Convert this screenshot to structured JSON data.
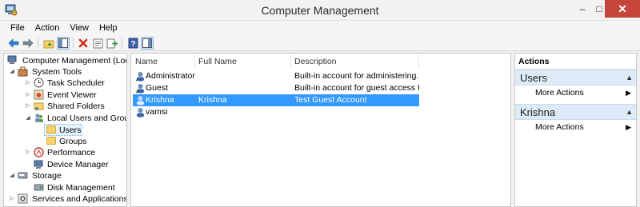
{
  "window": {
    "title": "Computer Management",
    "minimize_glyph": "–",
    "maximize_glyph": "□",
    "close_glyph": "✕"
  },
  "menu": [
    "File",
    "Action",
    "View",
    "Help"
  ],
  "toolbar": [
    {
      "icon": "back-arrow-icon"
    },
    {
      "icon": "forward-arrow-icon"
    },
    {
      "icon": "up-folder-icon"
    },
    {
      "icon": "show-hide-console-tree-icon"
    },
    {
      "icon": "delete-icon"
    },
    {
      "icon": "properties-icon"
    },
    {
      "icon": "export-list-icon"
    },
    {
      "icon": "help-icon"
    },
    {
      "icon": "show-hide-action-pane-icon"
    }
  ],
  "tree": {
    "root": "Computer Management (Local",
    "system_tools": "System Tools",
    "task_scheduler": "Task Scheduler",
    "event_viewer": "Event Viewer",
    "shared_folders": "Shared Folders",
    "local_users_groups": "Local Users and Groups",
    "users": "Users",
    "groups": "Groups",
    "performance": "Performance",
    "device_manager": "Device Manager",
    "storage": "Storage",
    "disk_management": "Disk Management",
    "services_apps": "Services and Applications"
  },
  "list": {
    "columns": [
      "Name",
      "Full Name",
      "Description"
    ],
    "rows": [
      {
        "name": "Administrator",
        "full_name": "",
        "description": "Built-in account for administering...",
        "selected": false
      },
      {
        "name": "Guest",
        "full_name": "",
        "description": "Built-in account for guest access t...",
        "selected": false
      },
      {
        "name": "Krishna",
        "full_name": "Krishna",
        "description": "Test Guest Account",
        "selected": true
      },
      {
        "name": "vamsi",
        "full_name": "",
        "description": "",
        "selected": false
      }
    ]
  },
  "actions": {
    "title": "Actions",
    "groups": [
      {
        "header": "Users",
        "items": [
          "More Actions"
        ]
      },
      {
        "header": "Krishna",
        "items": [
          "More Actions"
        ]
      }
    ]
  },
  "colors": {
    "selection": "#3399ff",
    "close_button": "#c7463c",
    "action_header": "#dcebf7"
  }
}
